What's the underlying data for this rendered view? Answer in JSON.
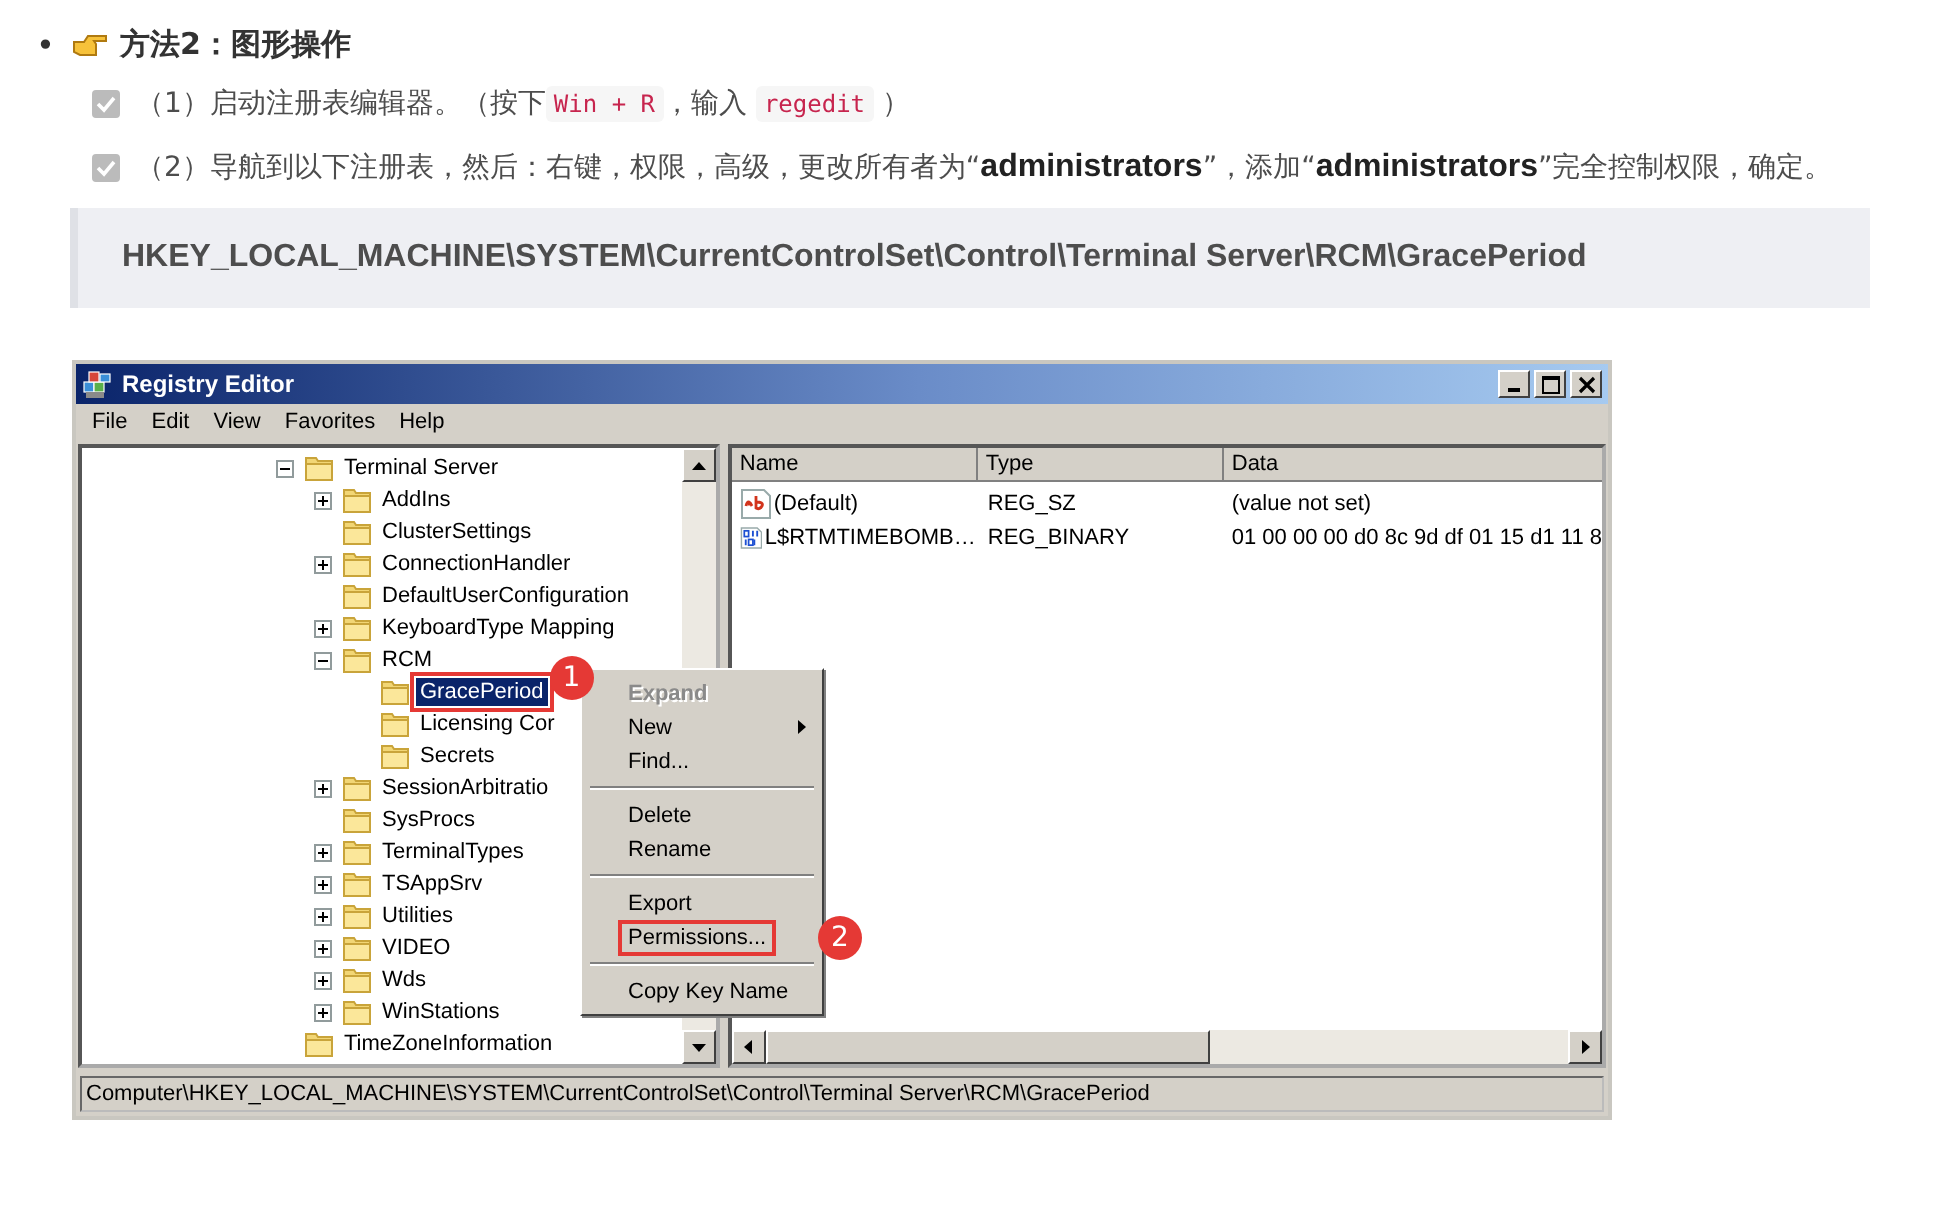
{
  "section": {
    "bullet": "•",
    "title": "方法2：图形操作"
  },
  "steps": [
    {
      "checked": true,
      "segments": [
        {
          "kind": "text",
          "text": "（1）启动注册表编辑器。（按下"
        },
        {
          "kind": "code",
          "text": "Win + R"
        },
        {
          "kind": "text",
          "text": "，输入 "
        },
        {
          "kind": "code",
          "text": "regedit"
        },
        {
          "kind": "text",
          "text": " ）"
        }
      ]
    },
    {
      "checked": true,
      "segments": [
        {
          "kind": "text",
          "text": "（2）导航到以下注册表，然后：右键，权限，高级，更改所有者为“**administrators**”，添加“**administrators**”完全控制权限，确定。"
        }
      ]
    }
  ],
  "code_block": "HKEY_LOCAL_MACHINE\\SYSTEM\\CurrentControlSet\\Control\\Terminal Server\\RCM\\GracePeriod",
  "window": {
    "title": "Registry Editor",
    "menu": [
      "File",
      "Edit",
      "View",
      "Favorites",
      "Help"
    ],
    "tree": [
      {
        "label": "Terminal Server",
        "expanded": true,
        "selected": false,
        "children": [
          {
            "label": "AddIns",
            "expanded": false,
            "selected": false
          },
          {
            "label": "ClusterSettings",
            "selected": false
          },
          {
            "label": "ConnectionHandler",
            "expanded": false,
            "selected": false
          },
          {
            "label": "DefaultUserConfiguration",
            "selected": false
          },
          {
            "label": "KeyboardType Mapping",
            "expanded": false,
            "selected": false
          },
          {
            "label": "RCM",
            "expanded": true,
            "selected": false,
            "children": [
              {
                "label": "GracePeriod",
                "selected": true,
                "badge": "1"
              },
              {
                "label": "Licensing Cor",
                "selected": false
              },
              {
                "label": "Secrets",
                "selected": false
              }
            ]
          },
          {
            "label": "SessionArbitratio",
            "expanded": false,
            "selected": false
          },
          {
            "label": "SysProcs",
            "selected": false
          },
          {
            "label": "TerminalTypes",
            "expanded": false,
            "selected": false
          },
          {
            "label": "TSAppSrv",
            "expanded": false,
            "selected": false
          },
          {
            "label": "Utilities",
            "expanded": false,
            "selected": false
          },
          {
            "label": "VIDEO",
            "expanded": false,
            "selected": false
          },
          {
            "label": "Wds",
            "expanded": false,
            "selected": false
          },
          {
            "label": "WinStations",
            "expanded": false,
            "selected": false
          }
        ]
      },
      {
        "label": "TimeZoneInformation",
        "selected": false
      }
    ],
    "columns": [
      "Name",
      "Type",
      "Data"
    ],
    "values": [
      {
        "kind": "string",
        "name": "(Default)",
        "type": "REG_SZ",
        "data": "(value not set)"
      },
      {
        "kind": "binary",
        "name": "L$RTMTIMEBOMB…",
        "type": "REG_BINARY",
        "data": "01 00 00 00 d0 8c 9d df 01 15 d1 11 8"
      }
    ],
    "context_menu": [
      {
        "kind": "item",
        "label": "Expand",
        "disabled": true,
        "highlighted": false
      },
      {
        "kind": "item",
        "label": "New",
        "disabled": false,
        "submenu": true,
        "highlighted": false
      },
      {
        "kind": "item",
        "label": "Find...",
        "disabled": false,
        "highlighted": false
      },
      {
        "kind": "separator"
      },
      {
        "kind": "item",
        "label": "Delete",
        "disabled": false,
        "highlighted": false
      },
      {
        "kind": "item",
        "label": "Rename",
        "disabled": false,
        "highlighted": false
      },
      {
        "kind": "separator"
      },
      {
        "kind": "item",
        "label": "Export",
        "disabled": false,
        "highlighted": false
      },
      {
        "kind": "item",
        "label": "Permissions...",
        "disabled": false,
        "highlighted": true,
        "badge": "2"
      },
      {
        "kind": "separator"
      },
      {
        "kind": "item",
        "label": "Copy Key Name",
        "disabled": false,
        "highlighted": false
      }
    ],
    "status_bar": "Computer\\HKEY_LOCAL_MACHINE\\SYSTEM\\CurrentControlSet\\Control\\Terminal Server\\RCM\\GracePeriod"
  }
}
